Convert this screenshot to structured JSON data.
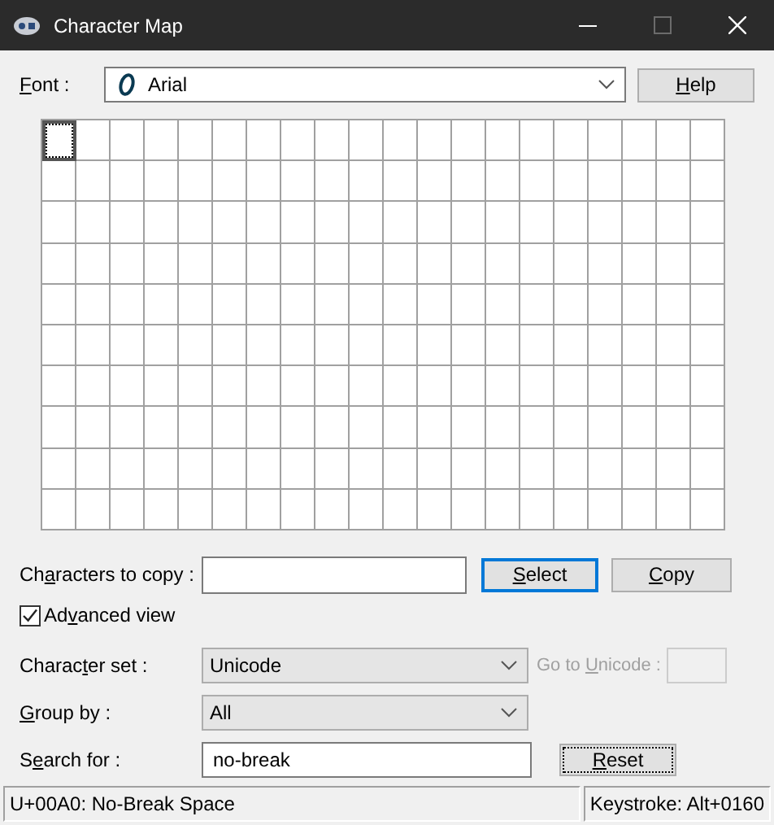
{
  "window": {
    "title": "Character Map",
    "controls": [
      {
        "kind": "minimize",
        "disabled": false
      },
      {
        "kind": "maximize",
        "disabled": true
      },
      {
        "kind": "close",
        "disabled": false
      }
    ]
  },
  "font": {
    "label": {
      "key": "F",
      "post": "ont :"
    },
    "value": "Arial",
    "help_button": {
      "key": "H",
      "post": "elp"
    }
  },
  "character_grid": {
    "rows": [
      {
        "cells": [
          {
            "selected": true
          },
          {
            "selected": false
          },
          {
            "selected": false
          },
          {
            "selected": false
          },
          {
            "selected": false
          },
          {
            "selected": false
          },
          {
            "selected": false
          },
          {
            "selected": false
          },
          {
            "selected": false
          },
          {
            "selected": false
          },
          {
            "selected": false
          },
          {
            "selected": false
          },
          {
            "selected": false
          },
          {
            "selected": false
          },
          {
            "selected": false
          },
          {
            "selected": false
          },
          {
            "selected": false
          },
          {
            "selected": false
          },
          {
            "selected": false
          },
          {
            "selected": false
          }
        ]
      },
      {
        "cells": [
          {
            "selected": false
          },
          {
            "selected": false
          },
          {
            "selected": false
          },
          {
            "selected": false
          },
          {
            "selected": false
          },
          {
            "selected": false
          },
          {
            "selected": false
          },
          {
            "selected": false
          },
          {
            "selected": false
          },
          {
            "selected": false
          },
          {
            "selected": false
          },
          {
            "selected": false
          },
          {
            "selected": false
          },
          {
            "selected": false
          },
          {
            "selected": false
          },
          {
            "selected": false
          },
          {
            "selected": false
          },
          {
            "selected": false
          },
          {
            "selected": false
          },
          {
            "selected": false
          }
        ]
      },
      {
        "cells": [
          {
            "selected": false
          },
          {
            "selected": false
          },
          {
            "selected": false
          },
          {
            "selected": false
          },
          {
            "selected": false
          },
          {
            "selected": false
          },
          {
            "selected": false
          },
          {
            "selected": false
          },
          {
            "selected": false
          },
          {
            "selected": false
          },
          {
            "selected": false
          },
          {
            "selected": false
          },
          {
            "selected": false
          },
          {
            "selected": false
          },
          {
            "selected": false
          },
          {
            "selected": false
          },
          {
            "selected": false
          },
          {
            "selected": false
          },
          {
            "selected": false
          },
          {
            "selected": false
          }
        ]
      },
      {
        "cells": [
          {
            "selected": false
          },
          {
            "selected": false
          },
          {
            "selected": false
          },
          {
            "selected": false
          },
          {
            "selected": false
          },
          {
            "selected": false
          },
          {
            "selected": false
          },
          {
            "selected": false
          },
          {
            "selected": false
          },
          {
            "selected": false
          },
          {
            "selected": false
          },
          {
            "selected": false
          },
          {
            "selected": false
          },
          {
            "selected": false
          },
          {
            "selected": false
          },
          {
            "selected": false
          },
          {
            "selected": false
          },
          {
            "selected": false
          },
          {
            "selected": false
          },
          {
            "selected": false
          }
        ]
      },
      {
        "cells": [
          {
            "selected": false
          },
          {
            "selected": false
          },
          {
            "selected": false
          },
          {
            "selected": false
          },
          {
            "selected": false
          },
          {
            "selected": false
          },
          {
            "selected": false
          },
          {
            "selected": false
          },
          {
            "selected": false
          },
          {
            "selected": false
          },
          {
            "selected": false
          },
          {
            "selected": false
          },
          {
            "selected": false
          },
          {
            "selected": false
          },
          {
            "selected": false
          },
          {
            "selected": false
          },
          {
            "selected": false
          },
          {
            "selected": false
          },
          {
            "selected": false
          },
          {
            "selected": false
          }
        ]
      },
      {
        "cells": [
          {
            "selected": false
          },
          {
            "selected": false
          },
          {
            "selected": false
          },
          {
            "selected": false
          },
          {
            "selected": false
          },
          {
            "selected": false
          },
          {
            "selected": false
          },
          {
            "selected": false
          },
          {
            "selected": false
          },
          {
            "selected": false
          },
          {
            "selected": false
          },
          {
            "selected": false
          },
          {
            "selected": false
          },
          {
            "selected": false
          },
          {
            "selected": false
          },
          {
            "selected": false
          },
          {
            "selected": false
          },
          {
            "selected": false
          },
          {
            "selected": false
          },
          {
            "selected": false
          }
        ]
      },
      {
        "cells": [
          {
            "selected": false
          },
          {
            "selected": false
          },
          {
            "selected": false
          },
          {
            "selected": false
          },
          {
            "selected": false
          },
          {
            "selected": false
          },
          {
            "selected": false
          },
          {
            "selected": false
          },
          {
            "selected": false
          },
          {
            "selected": false
          },
          {
            "selected": false
          },
          {
            "selected": false
          },
          {
            "selected": false
          },
          {
            "selected": false
          },
          {
            "selected": false
          },
          {
            "selected": false
          },
          {
            "selected": false
          },
          {
            "selected": false
          },
          {
            "selected": false
          },
          {
            "selected": false
          }
        ]
      },
      {
        "cells": [
          {
            "selected": false
          },
          {
            "selected": false
          },
          {
            "selected": false
          },
          {
            "selected": false
          },
          {
            "selected": false
          },
          {
            "selected": false
          },
          {
            "selected": false
          },
          {
            "selected": false
          },
          {
            "selected": false
          },
          {
            "selected": false
          },
          {
            "selected": false
          },
          {
            "selected": false
          },
          {
            "selected": false
          },
          {
            "selected": false
          },
          {
            "selected": false
          },
          {
            "selected": false
          },
          {
            "selected": false
          },
          {
            "selected": false
          },
          {
            "selected": false
          },
          {
            "selected": false
          }
        ]
      },
      {
        "cells": [
          {
            "selected": false
          },
          {
            "selected": false
          },
          {
            "selected": false
          },
          {
            "selected": false
          },
          {
            "selected": false
          },
          {
            "selected": false
          },
          {
            "selected": false
          },
          {
            "selected": false
          },
          {
            "selected": false
          },
          {
            "selected": false
          },
          {
            "selected": false
          },
          {
            "selected": false
          },
          {
            "selected": false
          },
          {
            "selected": false
          },
          {
            "selected": false
          },
          {
            "selected": false
          },
          {
            "selected": false
          },
          {
            "selected": false
          },
          {
            "selected": false
          },
          {
            "selected": false
          }
        ]
      },
      {
        "cells": [
          {
            "selected": false
          },
          {
            "selected": false
          },
          {
            "selected": false
          },
          {
            "selected": false
          },
          {
            "selected": false
          },
          {
            "selected": false
          },
          {
            "selected": false
          },
          {
            "selected": false
          },
          {
            "selected": false
          },
          {
            "selected": false
          },
          {
            "selected": false
          },
          {
            "selected": false
          },
          {
            "selected": false
          },
          {
            "selected": false
          },
          {
            "selected": false
          },
          {
            "selected": false
          },
          {
            "selected": false
          },
          {
            "selected": false
          },
          {
            "selected": false
          },
          {
            "selected": false
          }
        ]
      }
    ]
  },
  "characters_to_copy": {
    "label": {
      "pre": "Ch",
      "key": "a",
      "post": "racters to copy :"
    },
    "select_button": {
      "label": {
        "key": "S",
        "post": "elect"
      },
      "default": true,
      "focused": false
    },
    "copy_button": {
      "label": {
        "key": "C",
        "post": "opy"
      },
      "default": false,
      "focused": false
    }
  },
  "advanced_view": {
    "label": {
      "pre": "Ad",
      "key": "v",
      "post": "anced view"
    },
    "checked": true
  },
  "character_set": {
    "label": {
      "pre": "Charac",
      "key": "t",
      "post": "er set :"
    },
    "value": "Unicode"
  },
  "go_to_unicode": {
    "label": {
      "pre": "Go to ",
      "key": "U",
      "post": "nicode :"
    },
    "disabled": true
  },
  "group_by": {
    "label": {
      "key": "G",
      "post": "roup by :"
    },
    "value": "All"
  },
  "search_for": {
    "label": {
      "pre": "S",
      "key": "e",
      "post": "arch for :"
    },
    "value": "no-break",
    "reset_button": {
      "label": {
        "key": "R",
        "post": "eset"
      },
      "default": false,
      "focused": true
    }
  },
  "status_bar": {
    "character": "U+00A0: No-Break Space",
    "keystroke": "Keystroke: Alt+0160"
  }
}
